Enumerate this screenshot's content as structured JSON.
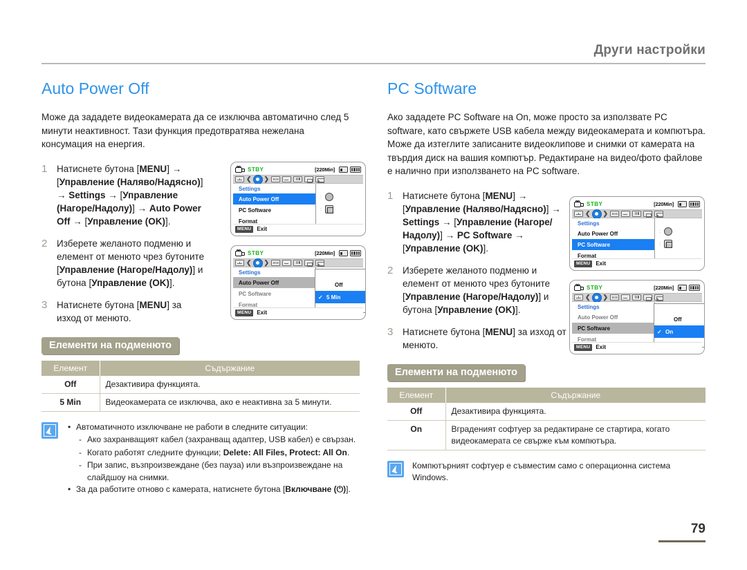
{
  "header": {
    "title": "Други настройки"
  },
  "page": {
    "number": "79"
  },
  "left": {
    "section_title": "Auto Power Off",
    "intro": "Може да зададете видеокамерата да се изключва автоматично след 5 минути неактивност. Тази функция предотвратява нежелана консумация на енергия.",
    "steps": [
      {
        "num": "1",
        "text_parts": {
          "a": "Натиснете бутона [",
          "b1": "MENU",
          "c": "] → [",
          "b2": "Управление (Наляво/Надясно)",
          "d": "] → ",
          "b3": "Settings",
          "e": " → [",
          "b4": "Управление (Нагоре/Надолу)",
          "f": "] → ",
          "b5": "Auto Power Off",
          "g": " → [",
          "b6": "Управление (OK)",
          "h": "]."
        }
      },
      {
        "num": "2",
        "text_parts": {
          "a": "Изберете желаното подменю и елемент от менюто чрез бутоните [",
          "b1": "Управление (Нагоре/Надолу)",
          "c": "] и бутона [",
          "b2": "Управление (OK)",
          "d": "]."
        }
      },
      {
        "num": "3",
        "text_parts": {
          "a": "Натиснете бутона [",
          "b1": "MENU",
          "c": "] за изход от менюто."
        }
      }
    ],
    "submenu_banner": "Елементи на подменюто",
    "table": {
      "headers": [
        "Елемент",
        "Съдържание"
      ],
      "rows": [
        {
          "item": "Off",
          "content": "Дезактивира функцията."
        },
        {
          "item": "5 Min",
          "content": "Видеокамерата се изключва, ако е неактивна за 5 минути."
        }
      ]
    },
    "note": {
      "bullet1": "Автоматичното изключване не работи в следните ситуации:",
      "sub1": "Ако захранващият кабел (захранващ адаптер, USB кабел) е свързан.",
      "sub2_pre": "Когато работят следните функции; ",
      "sub2_bold": "Delete: All Files, Protect: All On",
      "sub2_post": ".",
      "sub3": "При запис, възпроизвеждане (без пауза) или възпроизвеждане на слайдшоу на снимки.",
      "bullet2_pre": "За да работите отново с камерата, натиснете бутона [",
      "bullet2_bold": "Включване (⏻)",
      "bullet2_post": "]."
    },
    "lcd1": {
      "status": "STBY",
      "rectime": "[220Min]",
      "menu_title": "Settings",
      "rows": [
        "Auto Power Off",
        "PC Software",
        "Format"
      ],
      "selected_row": "Auto Power Off",
      "footer_key": "MENU",
      "footer_label": "Exit"
    },
    "lcd2": {
      "status": "STBY",
      "rectime": "[220Min]",
      "menu_title": "Settings",
      "rows": [
        "Auto Power Off",
        "PC Software",
        "Format"
      ],
      "selected_row": "Auto Power Off",
      "popup_options": [
        "Off",
        "5 Min"
      ],
      "popup_selected": "5 Min",
      "footer_key": "MENU",
      "footer_label": "Exit"
    }
  },
  "right": {
    "section_title": "PC Software",
    "intro": "Ако зададете PC Software на On, може просто за използвате PC software, като свържете USB кабела между видеокамерата и компютъра. Може да изтеглите записаните видеоклипове и снимки от камерата на твърдия диск на вашия компютър. Редактиране на видео/фото файлове е налично при използването на PC software.",
    "steps": [
      {
        "num": "1",
        "text_parts": {
          "a": "Натиснете бутона [",
          "b1": "MENU",
          "c": "] → [",
          "b2": "Управление (Наляво/Надясно)",
          "d": "] → ",
          "b3": "Settings",
          "e": " → [",
          "b4": "Управление (Нагоре/Надолу)",
          "f": "] → ",
          "b5": "PC Software",
          "g": " → [",
          "b6": "Управление (OK)",
          "h": "]."
        }
      },
      {
        "num": "2",
        "text_parts": {
          "a": "Изберете желаното подменю и елемент от менюто чрез бутоните [",
          "b1": "Управление (Нагоре/Надолу)",
          "c": "] и бутона [",
          "b2": "Управление (OK)",
          "d": "]."
        }
      },
      {
        "num": "3",
        "text_parts": {
          "a": "Натиснете бутона [",
          "b1": "MENU",
          "c": "] за изход от менюто."
        }
      }
    ],
    "submenu_banner": "Елементи на подменюто",
    "table": {
      "headers": [
        "Елемент",
        "Съдържание"
      ],
      "rows": [
        {
          "item": "Off",
          "content": "Дезактивира функцията."
        },
        {
          "item": "On",
          "content": "Вграденият софтуер за редактиране се стартира, когато видеокамерата се свърже към компютъра."
        }
      ]
    },
    "note": {
      "text": "Компютърният софтуер е съвместим само с операционна система Windows."
    },
    "lcd1": {
      "status": "STBY",
      "rectime": "[220Min]",
      "menu_title": "Settings",
      "rows": [
        "Auto Power Off",
        "PC Software",
        "Format"
      ],
      "selected_row": "PC Software",
      "footer_key": "MENU",
      "footer_label": "Exit"
    },
    "lcd2": {
      "status": "STBY",
      "rectime": "[220Min]",
      "menu_title": "Settings",
      "rows": [
        "Auto Power Off",
        "PC Software",
        "Format"
      ],
      "selected_row": "PC Software",
      "popup_options": [
        "Off",
        "On"
      ],
      "popup_selected": "On",
      "footer_key": "MENU",
      "footer_label": "Exit"
    }
  },
  "colors": {
    "heading_blue": "#2f94e8",
    "banner_olive": "#a3a18b",
    "table_header": "#b9b69e",
    "lcd_select_blue": "#1a7ff2",
    "stby_green": "#19b219"
  }
}
